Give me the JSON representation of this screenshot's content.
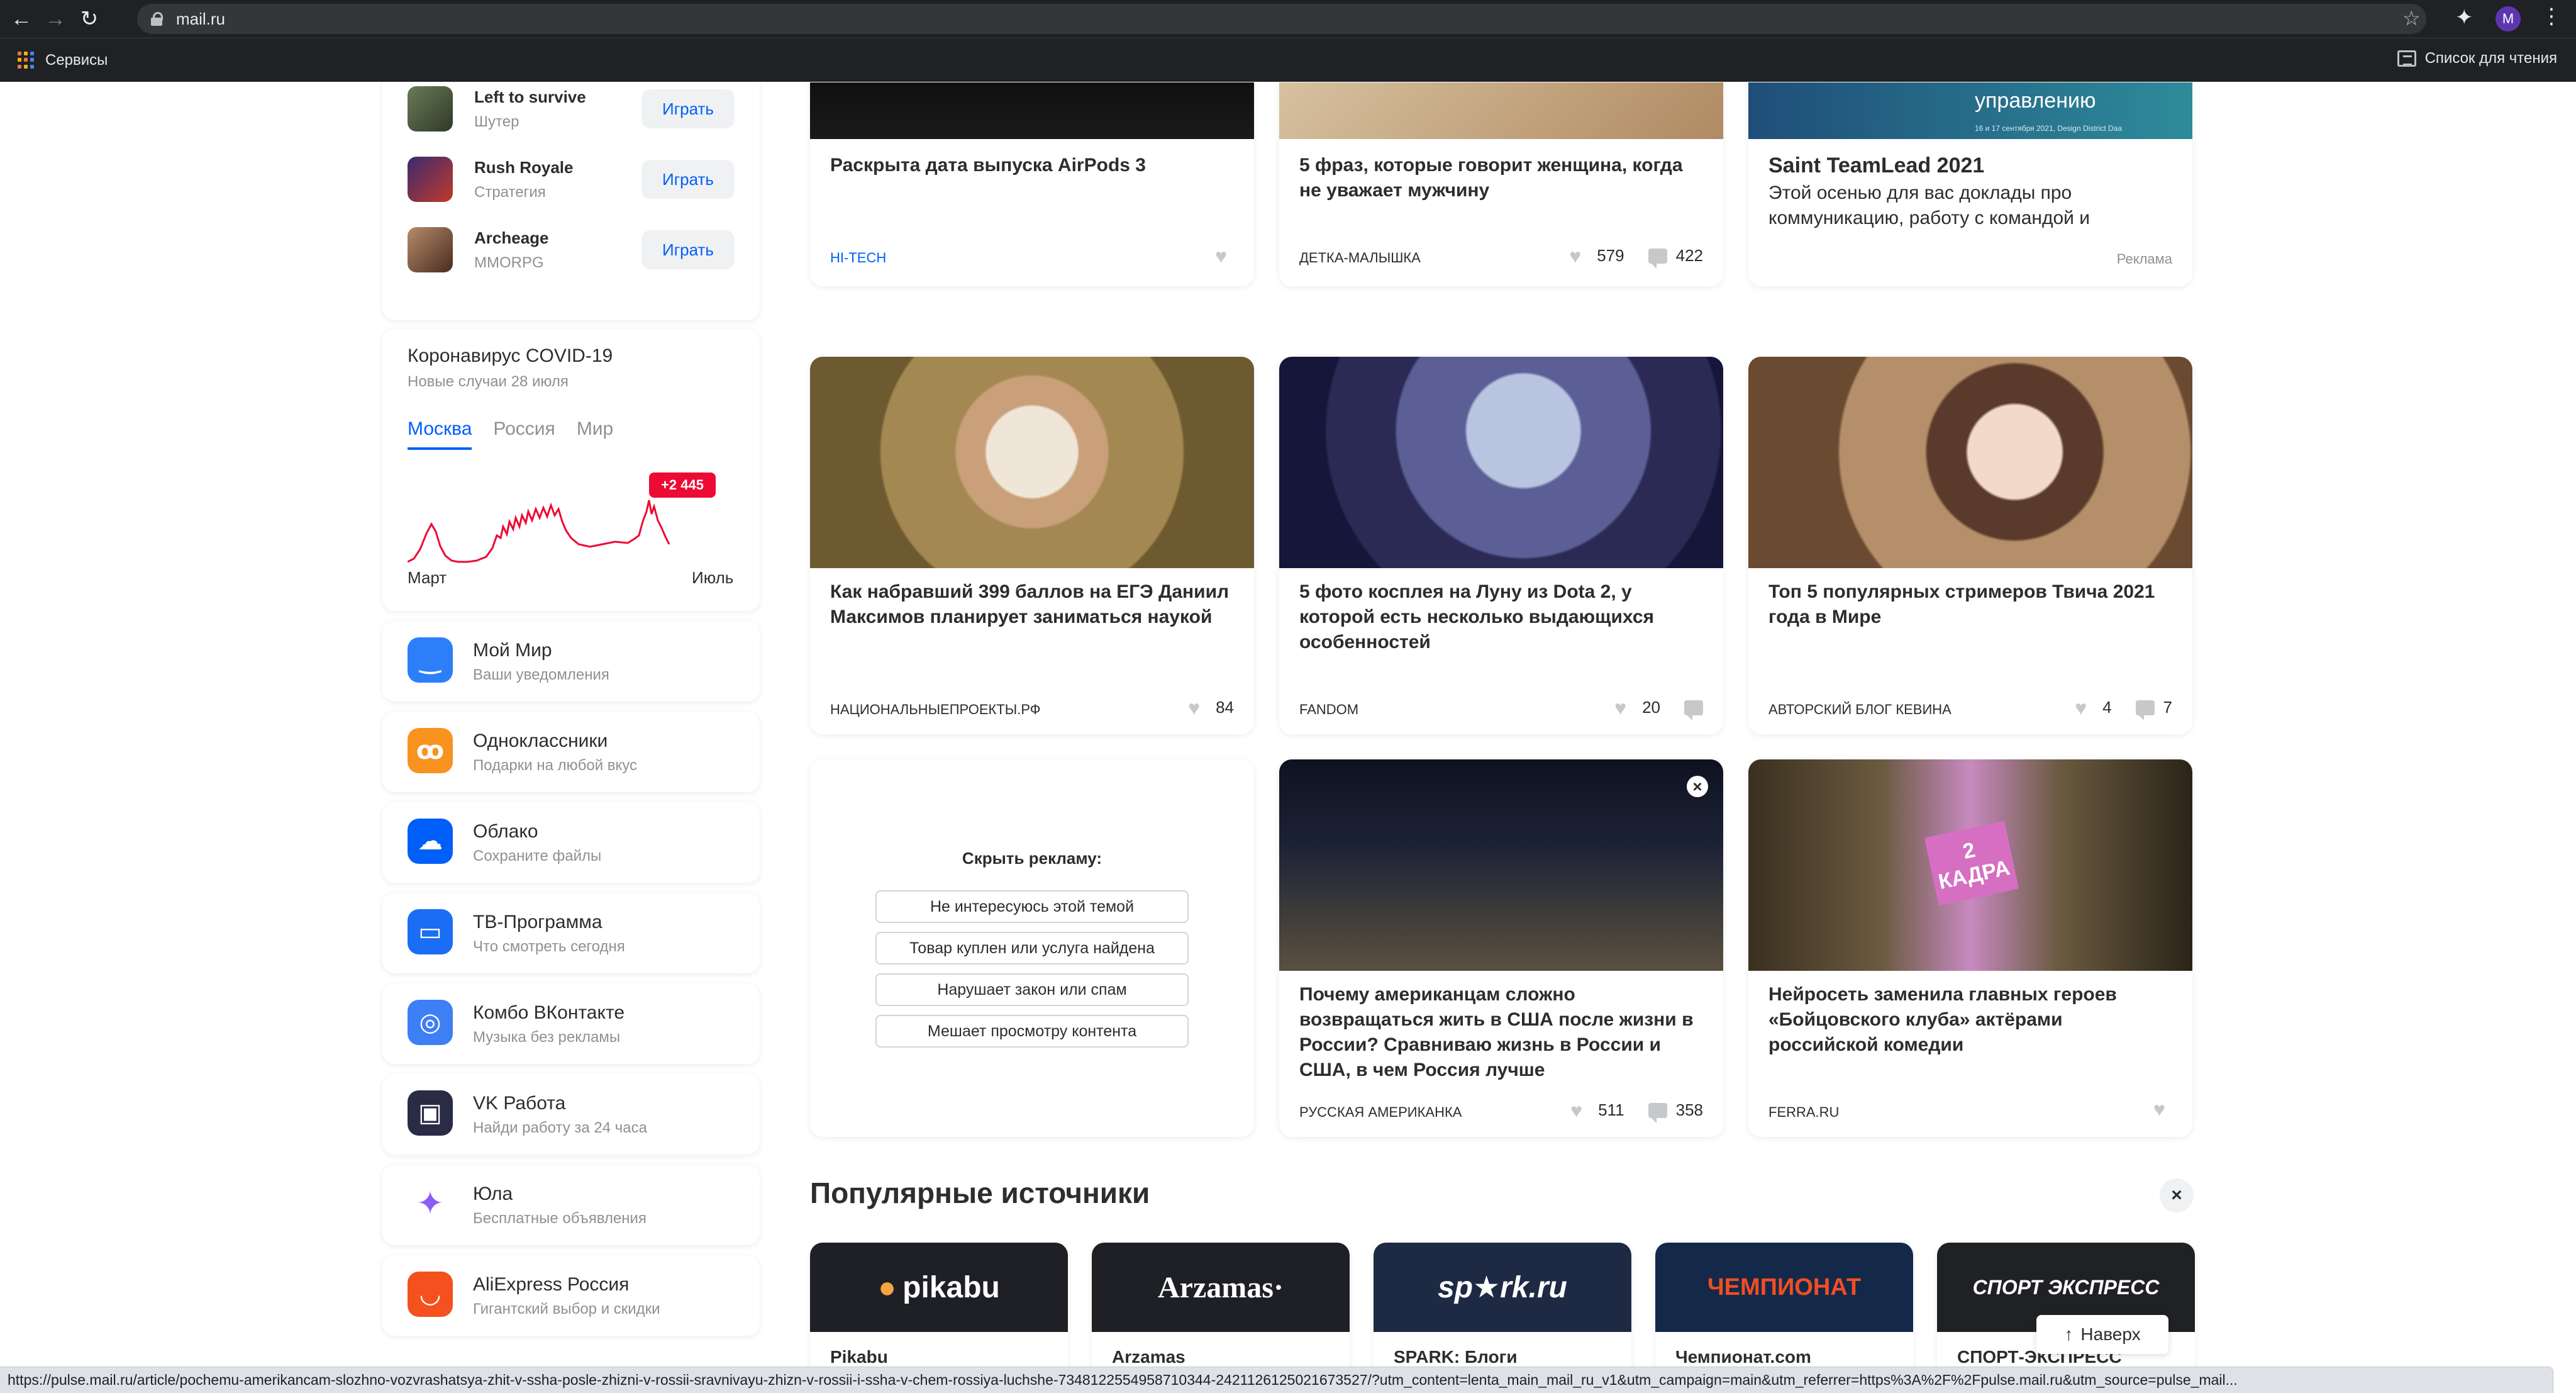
{
  "browser": {
    "url": "mail.ru",
    "bookmarks_label": "Сервисы",
    "reading_list_label": "Список для чтения",
    "profile_initial": "M",
    "status_url": "https://pulse.mail.ru/article/pochemu-amerikancam-slozhno-vozvrashatsya-zhit-v-ssha-posle-zhizni-v-rossii-sravnivayu-zhizn-v-rossii-i-ssha-v-chem-rossiya-luchshe-7348122554958710344-2421126125021673527/?utm_content=lenta_main_mail_ru_v1&utm_campaign=main&utm_referrer=https%3A%2F%2Fpulse.mail.ru&utm_source=pulse_mail..."
  },
  "games": {
    "play_label": "Играть",
    "items": [
      {
        "title": "Left to survive",
        "genre": "Шутер"
      },
      {
        "title": "Rush Royale",
        "genre": "Стратегия"
      },
      {
        "title": "Archeage",
        "genre": "MMORPG"
      }
    ]
  },
  "covid": {
    "title": "Коронавирус COVID-19",
    "subtitle": "Новые случаи 28 июля",
    "tabs": [
      "Москва",
      "Россия",
      "Мир"
    ],
    "active_tab": "Москва",
    "badge": "+2 445",
    "x_start": "Март",
    "x_end": "Июль",
    "accent": "#ed0a34"
  },
  "services": [
    {
      "title": "Мой Мир",
      "subtitle": "Ваши уведомления",
      "icon": "smile-icon",
      "color": "#2d7ff9"
    },
    {
      "title": "Одноклассники",
      "subtitle": "Подарки на любой вкус",
      "icon": "ok-icon",
      "color": "#f7931e"
    },
    {
      "title": "Облако",
      "subtitle": "Сохраните файлы",
      "icon": "cloud-icon",
      "color": "#005ff9"
    },
    {
      "title": "ТВ-Программа",
      "subtitle": "Что смотреть сегодня",
      "icon": "tv-icon",
      "color": "#1a6ef5"
    },
    {
      "title": "Комбо ВКонтакте",
      "subtitle": "Музыка без рекламы",
      "icon": "combo-icon",
      "color": "#3d7ff5"
    },
    {
      "title": "VK Работа",
      "subtitle": "Найди работу за 24 часа",
      "icon": "briefcase-icon",
      "color": "#2a2b45"
    },
    {
      "title": "Юла",
      "subtitle": "Бесплатные объявления",
      "icon": "sparkle-icon",
      "color": "#ffffff"
    },
    {
      "title": "AliExpress Россия",
      "subtitle": "Гигантский выбор и скидки",
      "icon": "aliexpress-icon",
      "color": "#f4511e"
    }
  ],
  "news": [
    {
      "title": "Раскрыта дата выпуска AirPods 3",
      "source": "HI-TECH",
      "likes": "",
      "comments": ""
    },
    {
      "title": "5 фраз, которые говорит женщина, когда не уважает мужчину",
      "source": "ДЕТКА-МАЛЫШКА",
      "likes": "579",
      "comments": "422"
    },
    {
      "title": "Saint TeamLead 2021",
      "description": "Этой осенью для вас доклады про коммуникацию, работу с командой и",
      "source": "Реклама",
      "banner_text": "управлению",
      "banner_date": "16 и 17 сентября 2021, Design District Daa"
    },
    {
      "title": "Как набравший 399 баллов на ЕГЭ Даниил Максимов планирует заниматься наукой",
      "source": "НАЦИОНАЛЬНЫЕПРОЕКТЫ.РФ",
      "likes": "84"
    },
    {
      "title": "5 фото косплея на Луну из Dota 2, у которой есть несколько выдающихся особенностей",
      "source": "FANDOM",
      "likes": "20",
      "comments": ""
    },
    {
      "title": "Топ 5 популярных стримеров Твича 2021 года в Мире",
      "source": "АВТОРСКИЙ БЛОГ КЕВИНА",
      "likes": "4",
      "comments": "7"
    },
    {
      "title": "Почему американцам сложно возвращаться жить в США после жизни в России? Сравниваю жизнь в России и США, в чем Россия лучше",
      "source": "РУССКАЯ АМЕРИКАНКА",
      "likes": "511",
      "comments": "358"
    },
    {
      "title": "Нейросеть заменила главных героев «Бойцовского клуба» актёрами российской комедии",
      "source": "FERRA.RU",
      "likes": "",
      "image_text": "2 КАДРА"
    }
  ],
  "hide_ad": {
    "title": "Скрыть рекламу:",
    "options": [
      "Не интересуюсь этой темой",
      "Товар куплен или услуга найдена",
      "Нарушает закон или спам",
      "Мешает просмотру контента"
    ]
  },
  "popular_sources": {
    "title": "Популярные источники",
    "items": [
      {
        "logo": "pikabu",
        "name": "Pikabu",
        "color": "#1f2025"
      },
      {
        "logo": "Arzamas·",
        "name": "Arzamas",
        "color": "#1f2025"
      },
      {
        "logo": "sp★rk.ru",
        "name": "SPARK: Блоги",
        "color": "#1e2a44"
      },
      {
        "logo": "ЧЕМПИОНАТ",
        "name": "Чемпионат.com",
        "color": "#14294a"
      },
      {
        "logo": "СПОРТ ЭКСПРЕСС",
        "name": "СПОРТ-ЭКСПРЕСС",
        "color": "#202124"
      }
    ]
  },
  "scroll_top_label": "Наверх"
}
